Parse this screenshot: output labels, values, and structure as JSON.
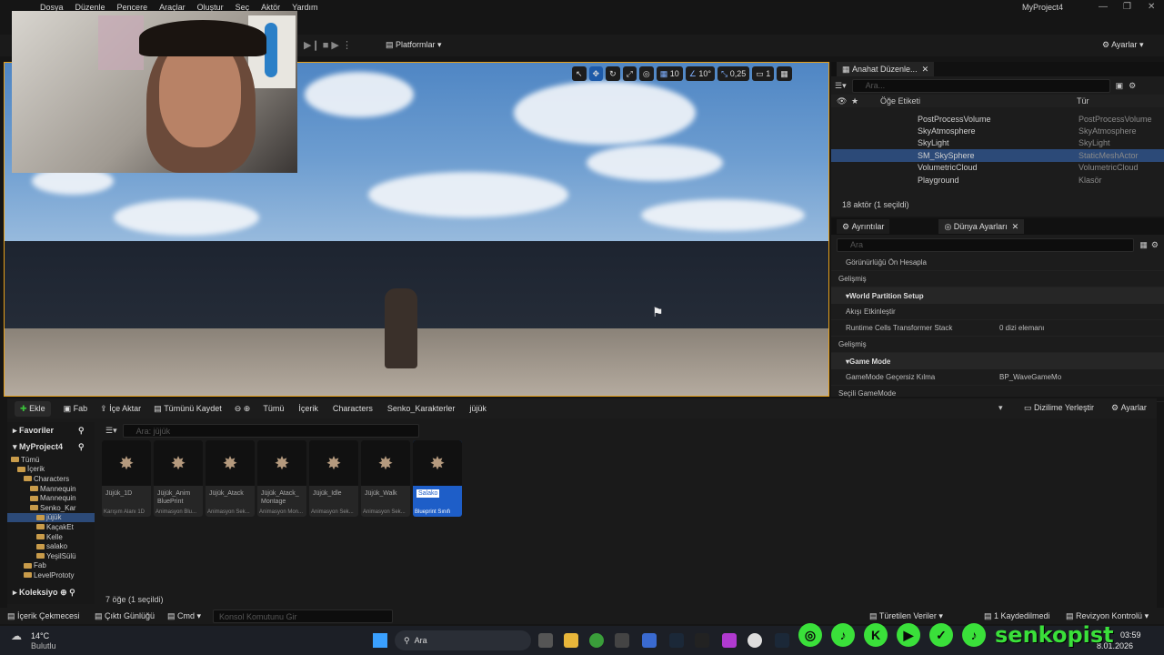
{
  "menu": [
    "Dosya",
    "Düzenle",
    "Pencere",
    "Araçlar",
    "Oluştur",
    "Seç",
    "Aktör",
    "Yardım"
  ],
  "project_name": "MyProject4",
  "toolbar": {
    "platforms": "Platformlar",
    "settings": "Ayarlar"
  },
  "viewport": {
    "grid": "10",
    "angle": "10°",
    "scale": "0,25",
    "camera": "1"
  },
  "outliner": {
    "tab": "Anahat Düzenle...",
    "search_placeholder": "Ara...",
    "col_label": "Öğe Etiketi",
    "col_type": "Tür",
    "rows": [
      {
        "name": "PostProcessVolume",
        "type": "PostProcessVolume"
      },
      {
        "name": "SkyAtmosphere",
        "type": "SkyAtmosphere"
      },
      {
        "name": "SkyLight",
        "type": "SkyLight"
      },
      {
        "name": "SM_SkySphere",
        "type": "StaticMeshActor",
        "selected": true
      },
      {
        "name": "VolumetricCloud",
        "type": "VolumetricCloud"
      },
      {
        "name": "Playground",
        "type": "Klasör"
      }
    ],
    "footer": "18 aktör (1 seçildi)"
  },
  "details": {
    "tab1": "Ayrıntılar",
    "tab2": "Dünya Ayarları",
    "search_placeholder": "Ara",
    "rows": [
      {
        "kind": "row",
        "label": "Görünürlüğü Ön Hesapla",
        "value": ""
      },
      {
        "kind": "sub",
        "label": "Gelişmiş"
      },
      {
        "kind": "sect",
        "label": "World Partition Setup"
      },
      {
        "kind": "row",
        "label": "Akışı Etkinleştir",
        "value": ""
      },
      {
        "kind": "row",
        "label": "Runtime Cells Transformer Stack",
        "value": "0 dizi elemanı"
      },
      {
        "kind": "sub",
        "label": "Gelişmiş"
      },
      {
        "kind": "sect",
        "label": "Game Mode"
      },
      {
        "kind": "row",
        "label": "GameMode Geçersiz Kılma",
        "value": "BP_WaveGameMo"
      },
      {
        "kind": "sub",
        "label": "Seçili GameMode"
      }
    ]
  },
  "content": {
    "add": "Ekle",
    "fab": "Fab",
    "import": "İçe Aktar",
    "saveall": "Tümünü Kaydet",
    "crumbs": [
      "Tümü",
      "İçerik",
      "Characters",
      "Senko_Karakterler",
      "jüjük"
    ],
    "dock": "Dizilime Yerleştir",
    "settings": "Ayarlar",
    "favorites": "Favoriler",
    "project": "MyProject4",
    "collections": "Koleksiyo",
    "search_placeholder": "Ara: jüjük",
    "tree": [
      {
        "label": "Tümü",
        "indent": 0
      },
      {
        "label": "İçerik",
        "indent": 1
      },
      {
        "label": "Characters",
        "indent": 2
      },
      {
        "label": "Mannequin",
        "indent": 3
      },
      {
        "label": "Mannequin",
        "indent": 3
      },
      {
        "label": "Senko_Kar",
        "indent": 3
      },
      {
        "label": "jüjük",
        "indent": 4,
        "selected": true
      },
      {
        "label": "KaçakEt",
        "indent": 4
      },
      {
        "label": "Kelle",
        "indent": 4
      },
      {
        "label": "salako",
        "indent": 4
      },
      {
        "label": "YeşilSülü",
        "indent": 4
      },
      {
        "label": "Fab",
        "indent": 2
      },
      {
        "label": "LevelPrototy",
        "indent": 2
      }
    ],
    "assets": [
      {
        "name": "Jüjük_1D",
        "type": "Karışım Alanı 1D"
      },
      {
        "name": "Jüjük_Anim BluePrint",
        "type": "Animasyon Blu..."
      },
      {
        "name": "Jüjük_Atack",
        "type": "Animasyon Sek..."
      },
      {
        "name": "Jüjük_Atack_ Montage",
        "type": "Animasyon Mon..."
      },
      {
        "name": "Jüjük_Idle",
        "type": "Animasyon Sek..."
      },
      {
        "name": "Jüjük_Walk",
        "type": "Animasyon Sek..."
      },
      {
        "name": "Salako",
        "type": "Blueprint Sınıfı",
        "selected": true
      }
    ],
    "count": "7 öğe (1 seçildi)"
  },
  "status": {
    "drawer": "İçerik Çekmecesi",
    "log": "Çıktı Günlüğü",
    "cmd": "Cmd",
    "console_placeholder": "Konsol Komutunu Gir",
    "derived": "Türetilen Veriler",
    "saved": "1 Kaydedilmedi",
    "revision": "Revizyon Kontrolü"
  },
  "taskbar": {
    "temp": "14°C",
    "weather": "Bulutlu",
    "search": "Ara",
    "time": "03:59",
    "date": "8.01.2026"
  },
  "overlay": {
    "handle": "senkopist"
  }
}
